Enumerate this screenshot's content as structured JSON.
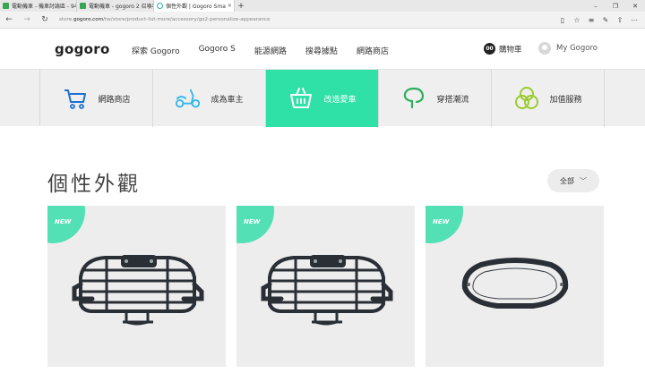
{
  "browser": {
    "tabs": [
      {
        "title": "電動機車 - 機車討論區 - 94c",
        "favicon": "green"
      },
      {
        "title": "電動機車 - gogoro 2 召喚客",
        "favicon": "green"
      },
      {
        "title": "個性外觀 | Gogoro Sma",
        "favicon": "ring",
        "active": true
      }
    ],
    "url_prefix": "store.",
    "url_domain": "gogoro.com",
    "url_path": "/tw/store/product-list-more/accessory/go2-personalize-appearance"
  },
  "header": {
    "logo": "gogoro",
    "nav": [
      "探索 Gogoro",
      "Gogoro S",
      "能源網路",
      "搜尋據點",
      "網路商店"
    ],
    "cart_count": "00",
    "cart_label": "購物車",
    "account_label": "My Gogoro"
  },
  "categories": [
    {
      "label": "網路商店",
      "icon": "cart-icon",
      "active": false
    },
    {
      "label": "成為車主",
      "icon": "scooter-icon",
      "active": false
    },
    {
      "label": "改造愛車",
      "icon": "basket-icon",
      "active": true
    },
    {
      "label": "穿搭潮流",
      "icon": "apparel-icon",
      "active": false
    },
    {
      "label": "加值服務",
      "icon": "services-icon",
      "active": false
    }
  ],
  "page": {
    "title": "個性外觀",
    "filter_label": "全部"
  },
  "products": [
    {
      "badge": "NEW",
      "image": "rear-rack"
    },
    {
      "badge": "NEW",
      "image": "rear-rack"
    },
    {
      "badge": "NEW",
      "image": "headlight-frame"
    }
  ],
  "colors": {
    "accent": "#2fe0a7",
    "badge": "#53e0b4",
    "icon_blue": "#1d6fd1",
    "icon_cyan": "#35b8e8",
    "icon_green": "#2fae5e",
    "icon_lime": "#9bcb2f"
  }
}
